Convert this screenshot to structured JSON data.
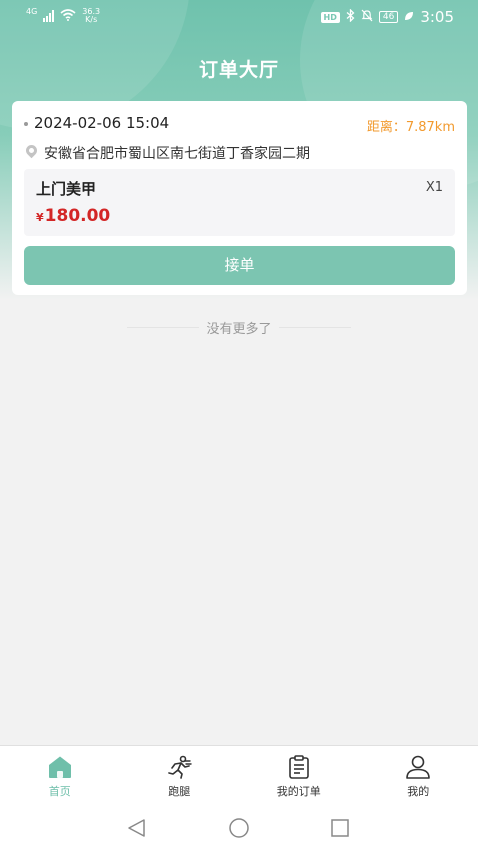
{
  "status_bar": {
    "network": "4G",
    "speed_value": "36.3",
    "speed_unit": "K/s",
    "hd": "HD",
    "battery": "46",
    "time": "3:05"
  },
  "header": {
    "title": "订单大厅"
  },
  "order": {
    "datetime": "2024-02-06 15:04",
    "distance": "距离：7.87km",
    "address": "安徽省合肥市蜀山区南七街道丁香家园二期",
    "service_name": "上门美甲",
    "quantity": "X1",
    "currency": "¥",
    "price": "180.00",
    "accept_label": "接单"
  },
  "list_end_text": "没有更多了",
  "tabs": [
    {
      "label": "首页",
      "icon": "home-icon",
      "active": true
    },
    {
      "label": "跑腿",
      "icon": "runner-icon",
      "active": false
    },
    {
      "label": "我的订单",
      "icon": "clipboard-icon",
      "active": false
    },
    {
      "label": "我的",
      "icon": "user-icon",
      "active": false
    }
  ],
  "colors": {
    "accent": "#7cc5b1",
    "price": "#d32626",
    "distance": "#f29a2e"
  }
}
